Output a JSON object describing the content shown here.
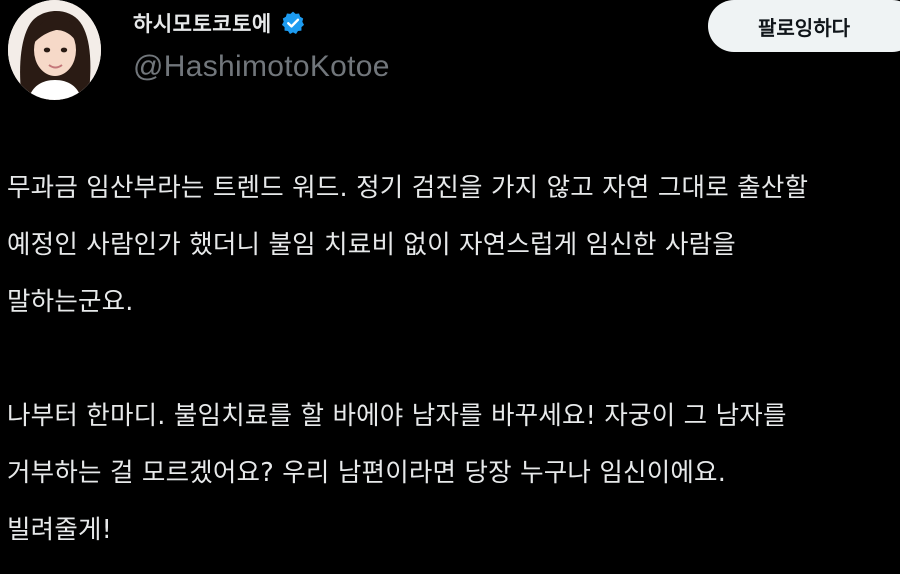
{
  "tweet": {
    "author": {
      "display_name": "하시모토코토에",
      "handle": "@HashimotoKotoe",
      "verified": true,
      "verified_icon": "verified-badge-icon",
      "avatar_icon": "avatar-photo"
    },
    "follow_button_label": "팔로잉하다",
    "paragraphs": [
      {
        "lines": [
          "무과금 임산부라는 트렌드 워드. 정기 검진을 가지 않고 자연 그대로 출산할",
          "예정인 사람인가 했더니 불임 치료비 없이 자연스럽게 임신한 사람을",
          "말하는군요."
        ]
      },
      {
        "lines": [
          "나부터 한마디. 불임치료를 할 바에야 남자를 바꾸세요! 자궁이 그 남자를",
          "거부하는 걸 모르겠어요? 우리 남편이라면 당장 누구나 임신이에요.",
          "빌려줄게!"
        ]
      }
    ]
  },
  "colors": {
    "background": "#000000",
    "text_primary": "#e7e9ea",
    "text_secondary": "#71767b",
    "verified_blue": "#1d9bf0",
    "button_bg": "#eff3f4",
    "button_text": "#0f1419"
  }
}
